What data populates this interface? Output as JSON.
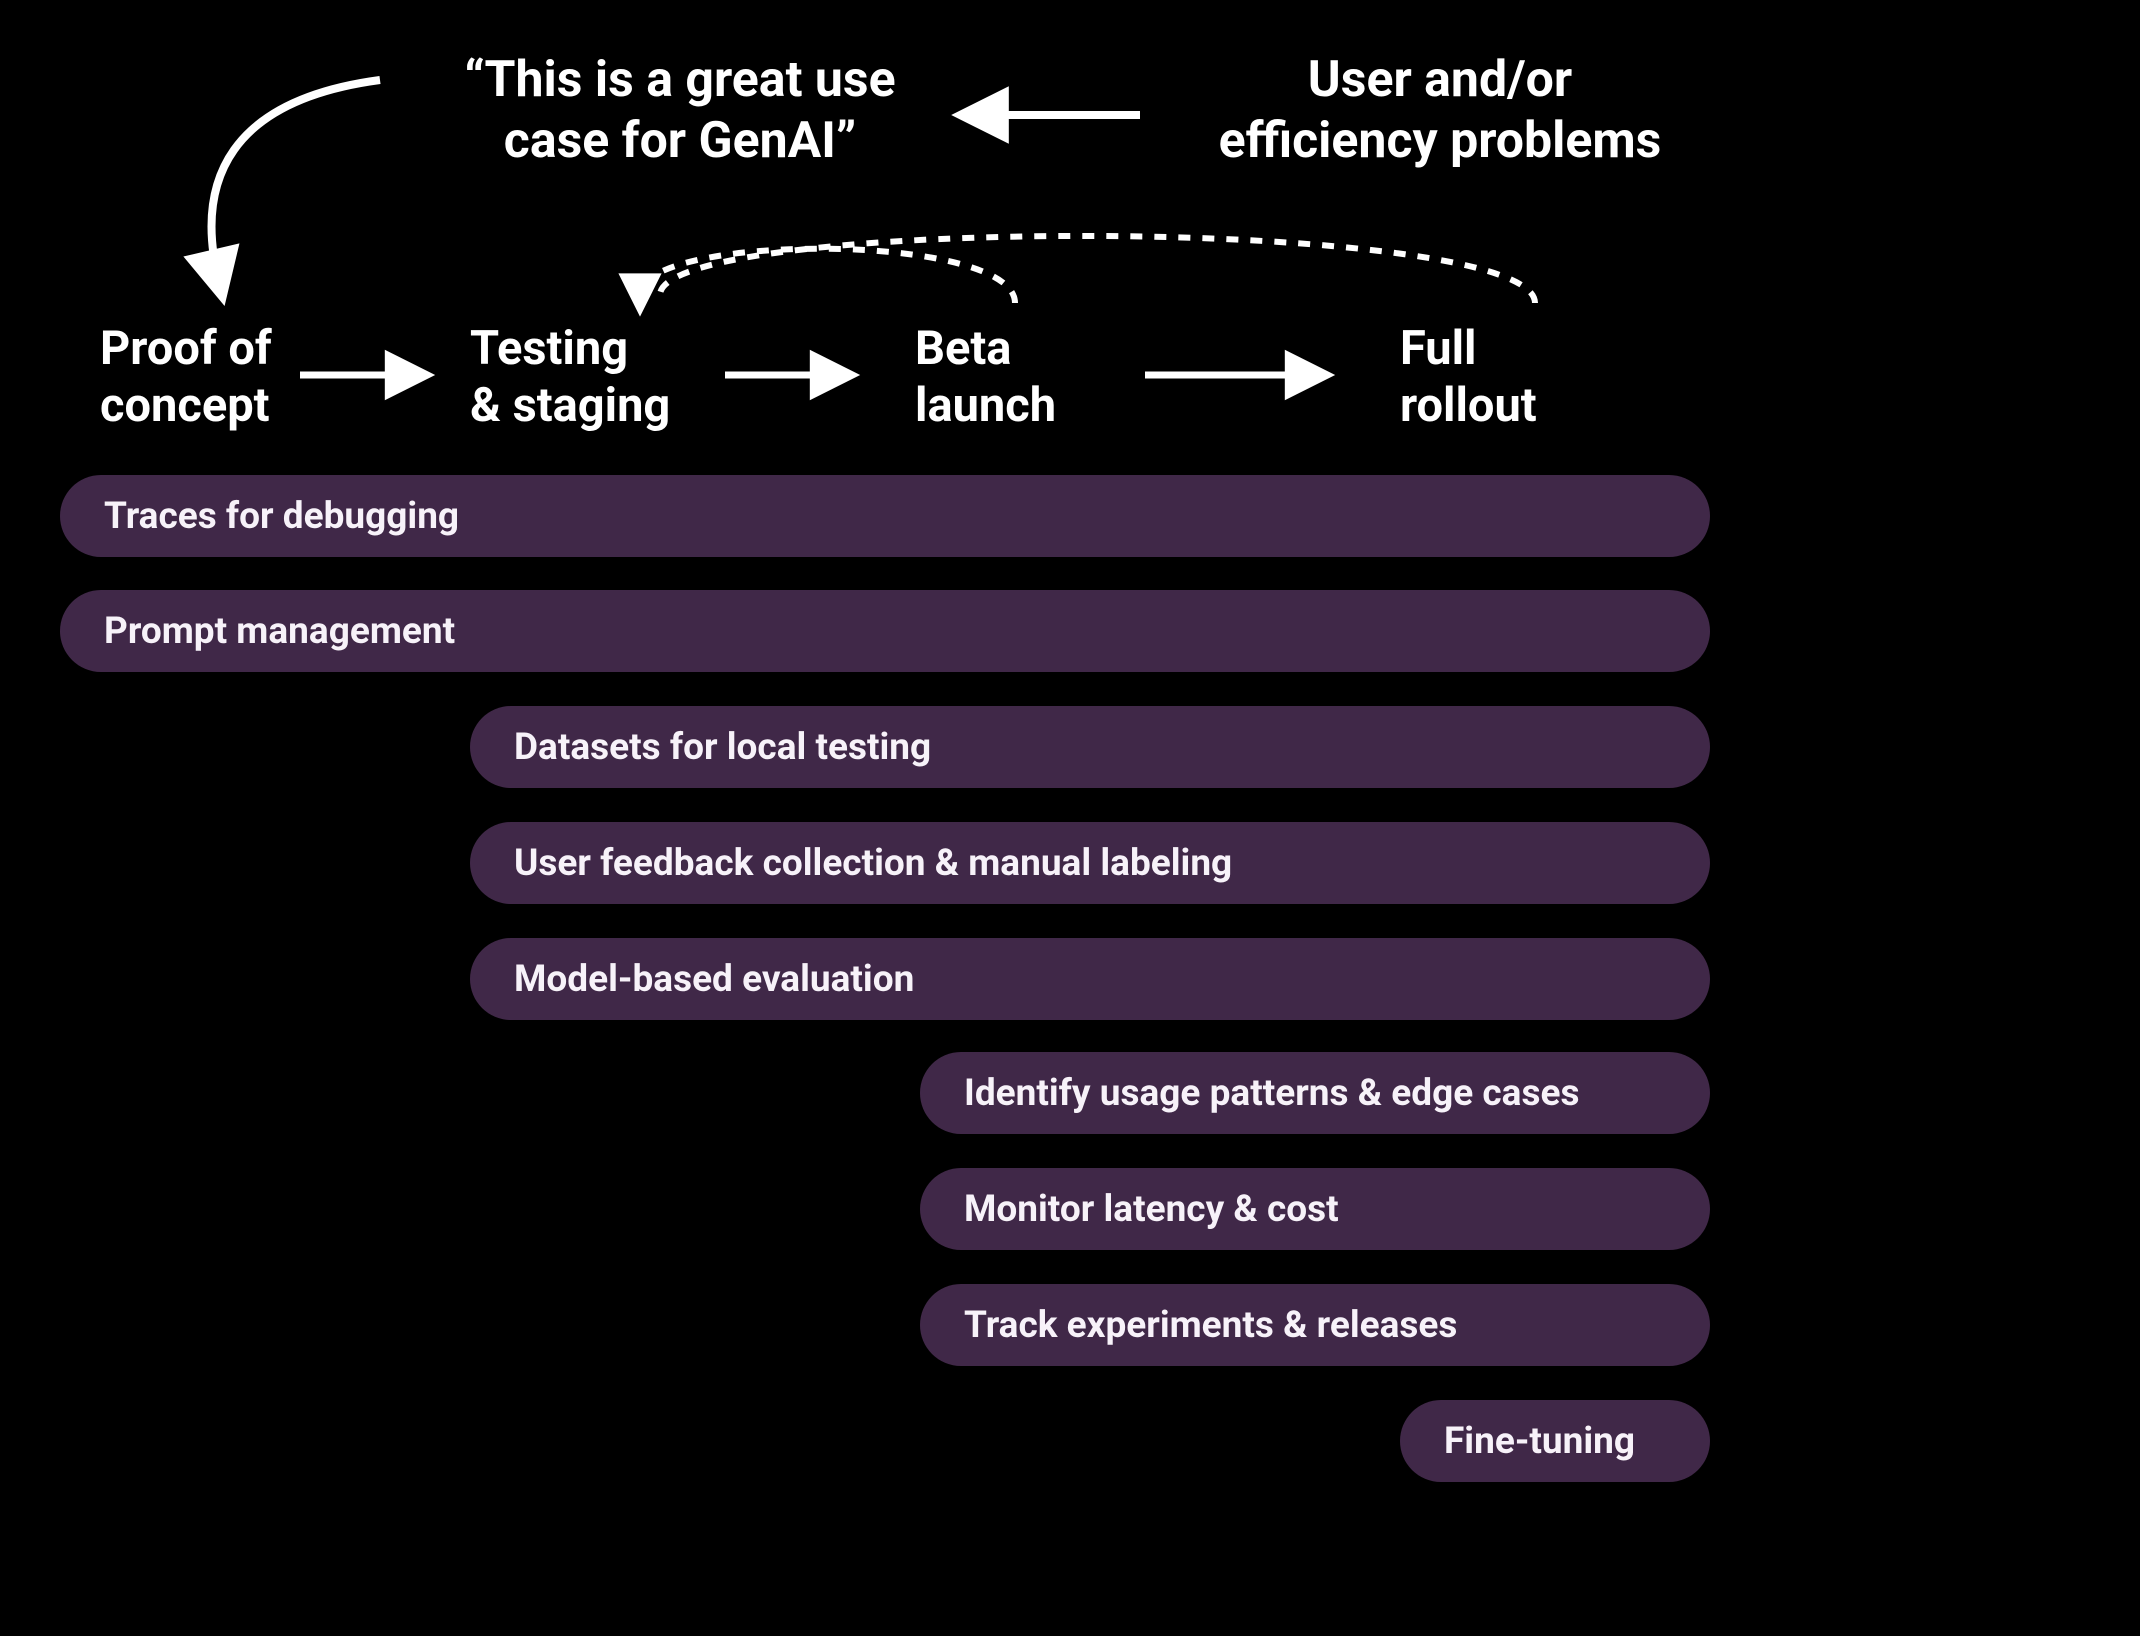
{
  "top": {
    "quote": "“This is a great use\ncase for GenAI”",
    "problems": "User and/or\nefficiency problems"
  },
  "stages": {
    "poc": "Proof of\nconcept",
    "testing": "Testing\n& staging",
    "beta": "Beta\nlaunch",
    "rollout": "Full\nrollout"
  },
  "pills": {
    "traces": "Traces for debugging",
    "prompt": "Prompt management",
    "datasets": "Datasets for local testing",
    "feedback": "User feedback collection & manual labeling",
    "eval": "Model-based evaluation",
    "patterns": "Identify usage patterns & edge cases",
    "latency": "Monitor latency & cost",
    "experiments": "Track experiments & releases",
    "finetune": "Fine-tuning"
  },
  "colors": {
    "pill_bg": "#402848",
    "pill_text": "#F7F2F9",
    "bg": "#000000",
    "fg": "#FFFFFF"
  }
}
